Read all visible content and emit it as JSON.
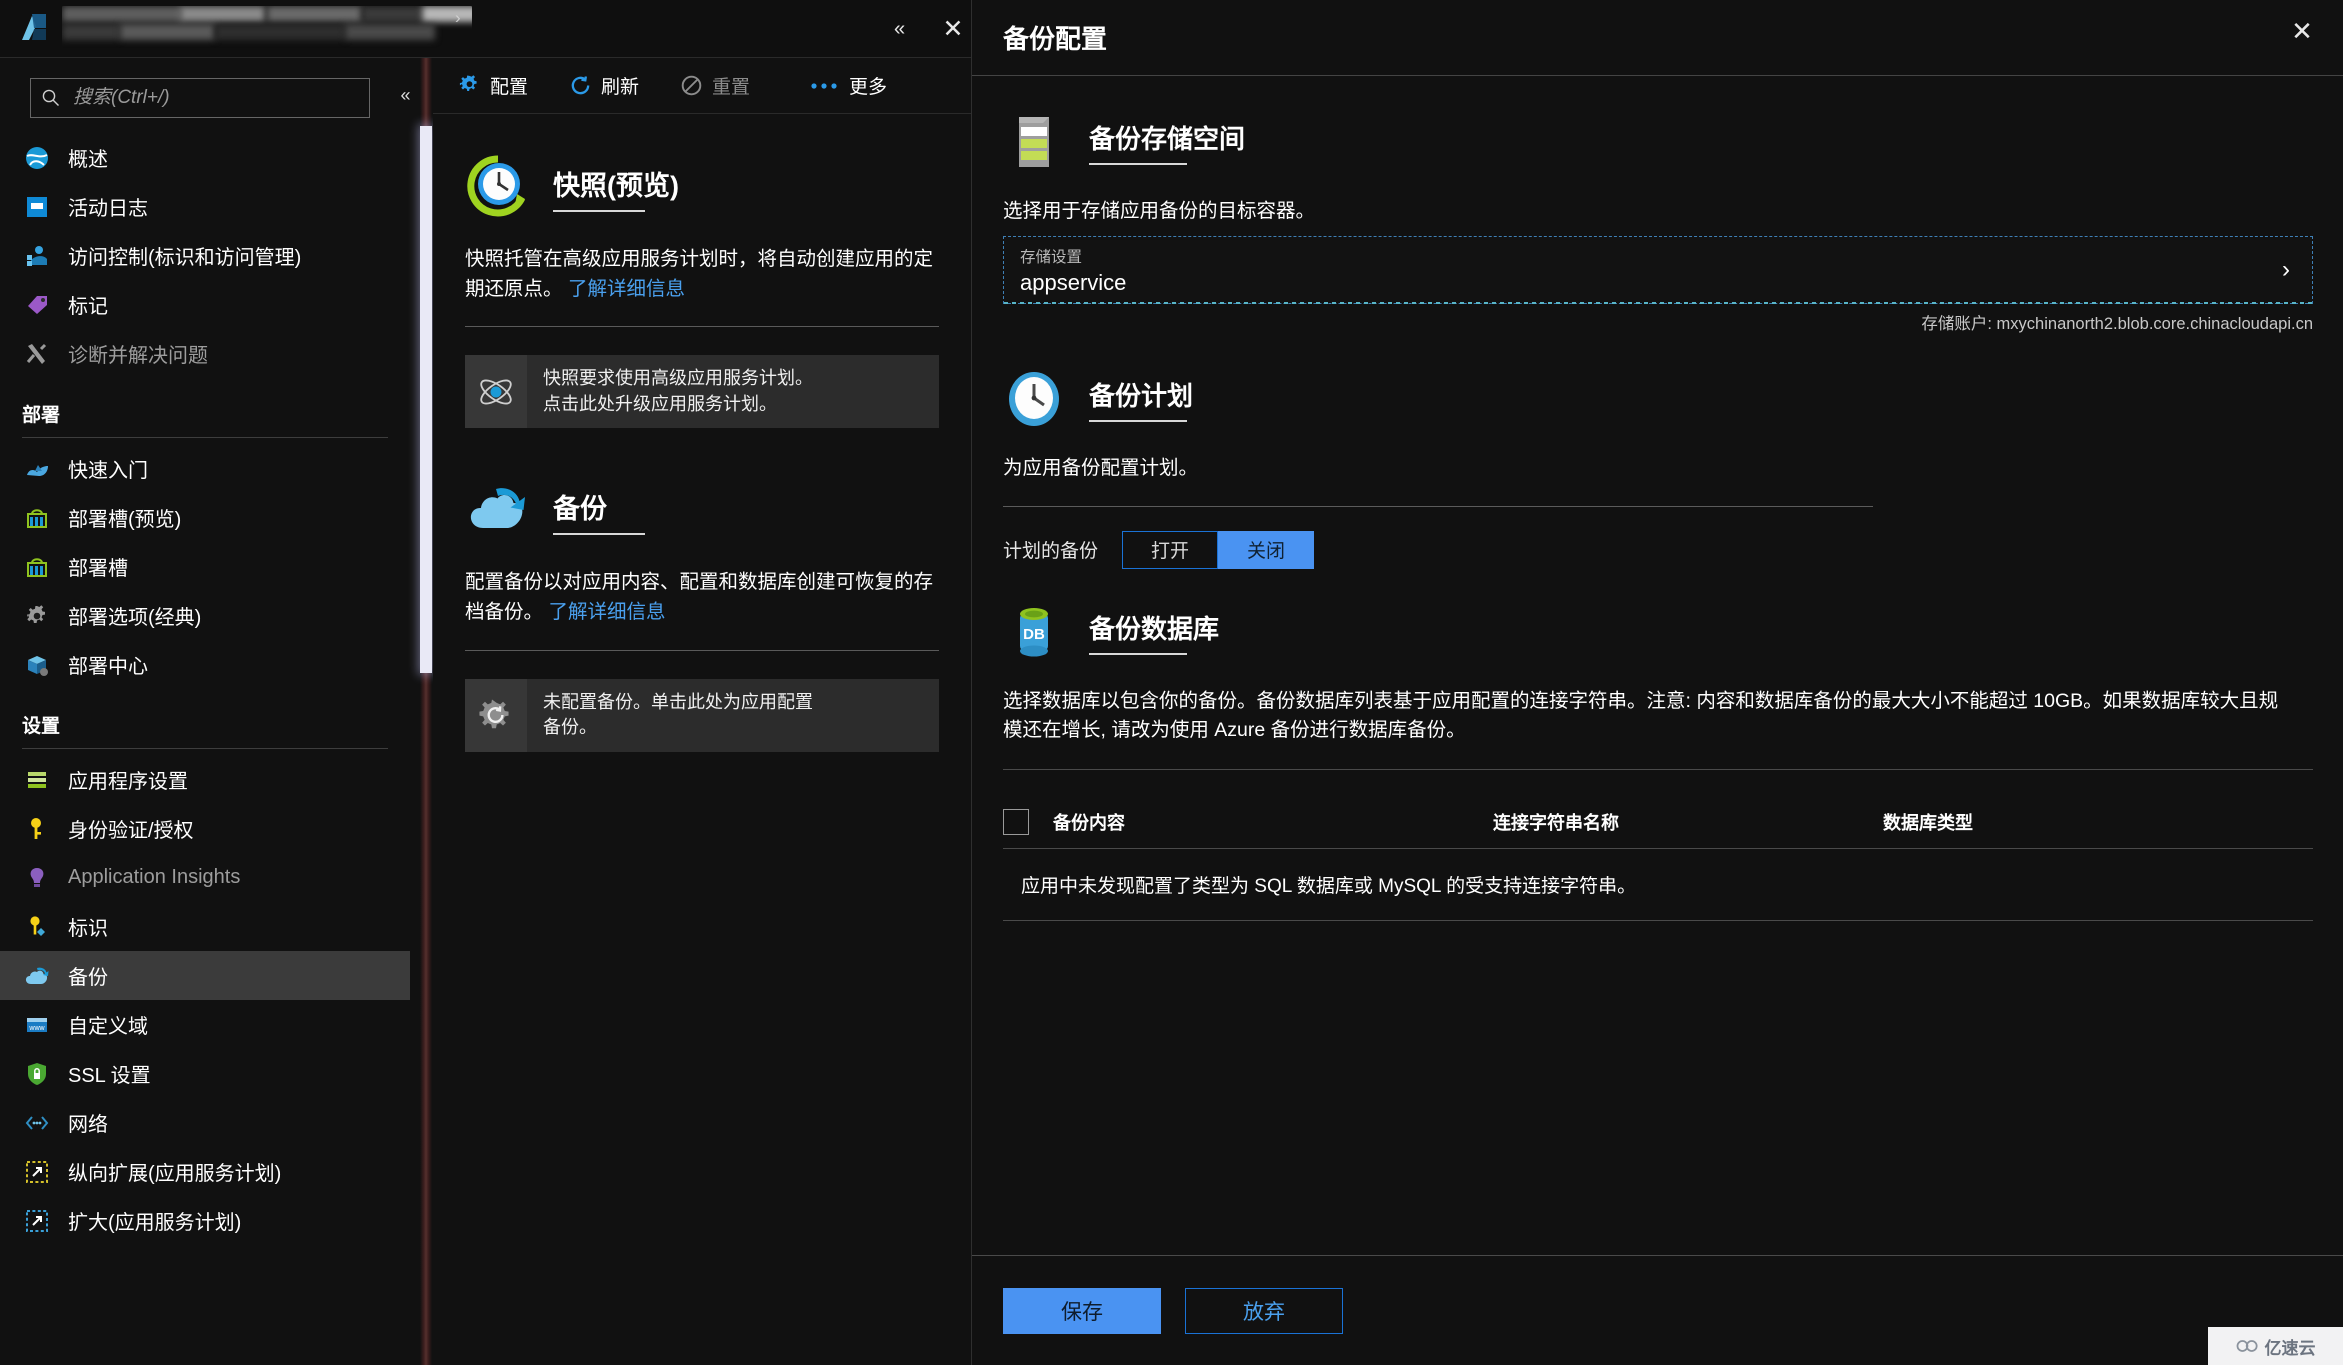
{
  "header": {
    "app_icon": "app-service-icon",
    "title_redacted": true,
    "collapse_label": "«",
    "close_label": "✕"
  },
  "sidebar": {
    "search": {
      "placeholder": "搜索(Ctrl+/)",
      "value": "",
      "icon": "search-icon"
    },
    "collapse_label": "«",
    "items": [
      {
        "label": "概述",
        "icon": "overview-globe-icon",
        "selected": false,
        "dim": false
      },
      {
        "label": "活动日志",
        "icon": "activity-log-icon",
        "selected": false,
        "dim": false
      },
      {
        "label": "访问控制(标识和访问管理)",
        "icon": "access-control-icon",
        "selected": false,
        "dim": false
      },
      {
        "label": "标记",
        "icon": "tag-icon",
        "selected": false,
        "dim": false
      },
      {
        "label": "诊断并解决问题",
        "icon": "diagnose-tools-icon",
        "selected": false,
        "dim": true
      }
    ],
    "groups": [
      {
        "title": "部署",
        "items": [
          {
            "label": "快速入门",
            "icon": "quickstart-rocket-icon",
            "selected": false,
            "dim": false
          },
          {
            "label": "部署槽(预览)",
            "icon": "deployment-slot-icon",
            "selected": false,
            "dim": false
          },
          {
            "label": "部署槽",
            "icon": "deployment-slot-icon",
            "selected": false,
            "dim": false
          },
          {
            "label": "部署选项(经典)",
            "icon": "gear-icon",
            "selected": false,
            "dim": false
          },
          {
            "label": "部署中心",
            "icon": "deployment-center-box-icon",
            "selected": false,
            "dim": false
          }
        ]
      },
      {
        "title": "设置",
        "items": [
          {
            "label": "应用程序设置",
            "icon": "app-settings-icon",
            "selected": false,
            "dim": false
          },
          {
            "label": "身份验证/授权",
            "icon": "key-icon",
            "selected": false,
            "dim": false
          },
          {
            "label": "Application Insights",
            "icon": "insights-bulb-icon",
            "selected": false,
            "dim": true
          },
          {
            "label": "标识",
            "icon": "identity-key-icon",
            "selected": false,
            "dim": false
          },
          {
            "label": "备份",
            "icon": "backup-cloud-icon",
            "selected": true,
            "dim": false
          },
          {
            "label": "自定义域",
            "icon": "custom-domain-www-icon",
            "selected": false,
            "dim": false
          },
          {
            "label": "SSL 设置",
            "icon": "ssl-shield-icon",
            "selected": false,
            "dim": false
          },
          {
            "label": "网络",
            "icon": "networking-icon",
            "selected": false,
            "dim": false
          },
          {
            "label": "纵向扩展(应用服务计划)",
            "icon": "scale-up-icon",
            "selected": false,
            "dim": false
          },
          {
            "label": "扩大(应用服务计划)",
            "icon": "scale-out-icon",
            "selected": false,
            "dim": false
          }
        ]
      }
    ]
  },
  "toolbar": {
    "buttons": [
      {
        "label": "配置",
        "icon": "gear-blue-icon",
        "disabled": false
      },
      {
        "label": "刷新",
        "icon": "refresh-icon",
        "disabled": false
      },
      {
        "label": "重置",
        "icon": "reset-blocked-icon",
        "disabled": true
      },
      {
        "label": "更多",
        "icon": "ellipsis-icon",
        "disabled": false
      }
    ]
  },
  "middle": {
    "snapshot": {
      "icon": "snapshot-clock-icon",
      "title": "快照(预览)",
      "desc": "快照托管在高级应用服务计划时，将自动创建应用的定期还原点。",
      "link": "了解详细信息",
      "notice_icon": "atom-icon",
      "notice_line1": "快照要求使用高级应用服务计划。",
      "notice_line2": "点击此处升级应用服务计划。"
    },
    "backup": {
      "icon": "backup-cloud-icon",
      "title": "备份",
      "desc": "配置备份以对应用内容、配置和数据库创建可恢复的存档备份。",
      "link": "了解详细信息",
      "notice_icon": "gear-refresh-icon",
      "notice_line1": "未配置备份。单击此处为应用配置",
      "notice_line2": "备份。"
    }
  },
  "blade": {
    "title": "备份配置",
    "close_label": "✕",
    "storage": {
      "icon": "storage-stack-icon",
      "title": "备份存储空间",
      "desc": "选择用于存储应用备份的目标容器。",
      "field_label": "存储设置",
      "field_value": "appservice",
      "chevron": "›",
      "account_note": "存储账户: mxychinanorth2.blob.core.chinacloudapi.cn"
    },
    "schedule": {
      "icon": "clock-icon",
      "title": "备份计划",
      "desc": "为应用备份配置计划。",
      "toggle_label": "计划的备份",
      "options": [
        {
          "label": "打开",
          "active": false
        },
        {
          "label": "关闭",
          "active": true
        }
      ]
    },
    "database": {
      "icon": "database-db-icon",
      "title": "备份数据库",
      "desc": "选择数据库以包含你的备份。备份数据库列表基于应用配置的连接字符串。注意: 内容和数据库备份的最大大小不能超过 10GB。如果数据库较大且规模还在增长, 请改为使用 Azure 备份进行数据库备份。",
      "columns": [
        "备份内容",
        "连接字符串名称",
        "数据库类型"
      ],
      "rows": [],
      "empty_text": "应用中未发现配置了类型为 SQL 数据库或 MySQL 的受支持连接字符串。"
    },
    "footer": {
      "save_label": "保存",
      "discard_label": "放弃"
    }
  },
  "watermark": {
    "text": "亿速云",
    "icon": "cloud-logo-icon"
  },
  "colors": {
    "accent_blue": "#4a93f2",
    "link_blue": "#4aa0ee",
    "background": "#111111",
    "selected_nav": "#3b3b3b"
  }
}
